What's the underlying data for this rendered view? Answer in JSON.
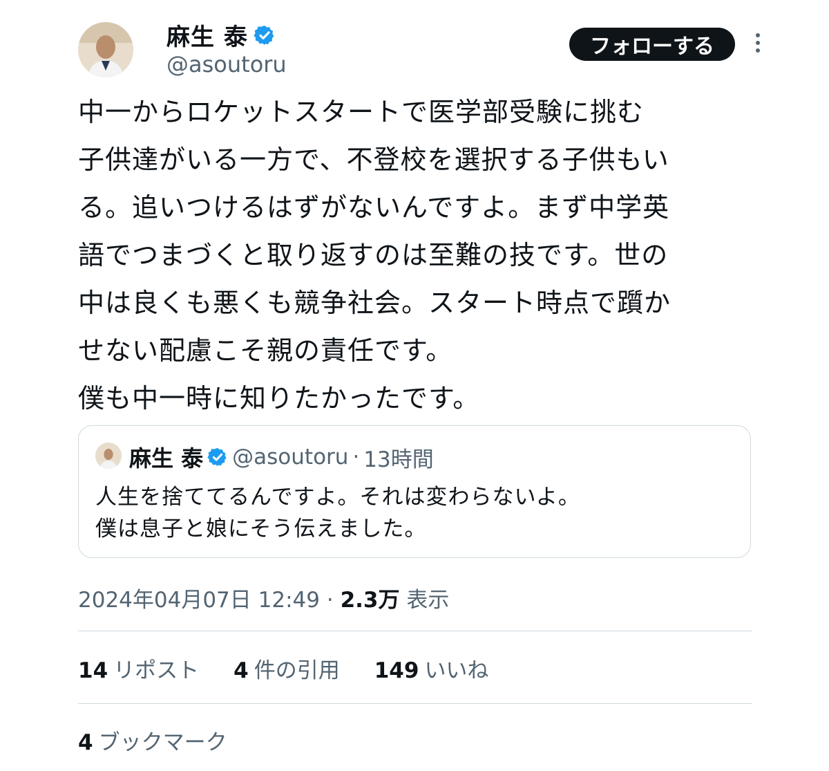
{
  "author": {
    "name": "麻生 泰",
    "handle": "@asoutoru",
    "avatar_icon": "avatar-photo"
  },
  "follow_button_label": "フォローする",
  "tweet_lines": [
    "中一からロケットスタートで医学部受験に挑む",
    "子供達がいる一方で、不登校を選択する子供もい",
    "る。追いつけるはずがないんですよ。まず中学英",
    "語でつまづくと取り返すのは至難の技です。世の",
    "中は良くも悪くも競争社会。スタート時点で躓か",
    "せない配慮こそ親の責任です。",
    "僕も中一時に知りたかったです。"
  ],
  "quote": {
    "name": "麻生 泰",
    "handle": "@asoutoru",
    "separator": "·",
    "time": "13時間",
    "lines": [
      "人生を捨ててるんですよ。それは変わらないよ。",
      "僕は息子と娘にそう伝えました。"
    ]
  },
  "meta": {
    "timestamp": "2024年04月07日 12:49",
    "separator": "·",
    "views_count": "2.3万",
    "views_label": "表示"
  },
  "stats": [
    {
      "count": "14",
      "label": "リポスト"
    },
    {
      "count": "4",
      "label": "件の引用"
    },
    {
      "count": "149",
      "label": "いいね"
    }
  ],
  "bookmarks": {
    "count": "4",
    "label": "ブックマーク"
  },
  "colors": {
    "text_primary": "#0f1419",
    "text_secondary": "#536471",
    "verified_blue": "#1d9bf0",
    "border": "#cfd9de",
    "button_bg": "#0f1419"
  }
}
